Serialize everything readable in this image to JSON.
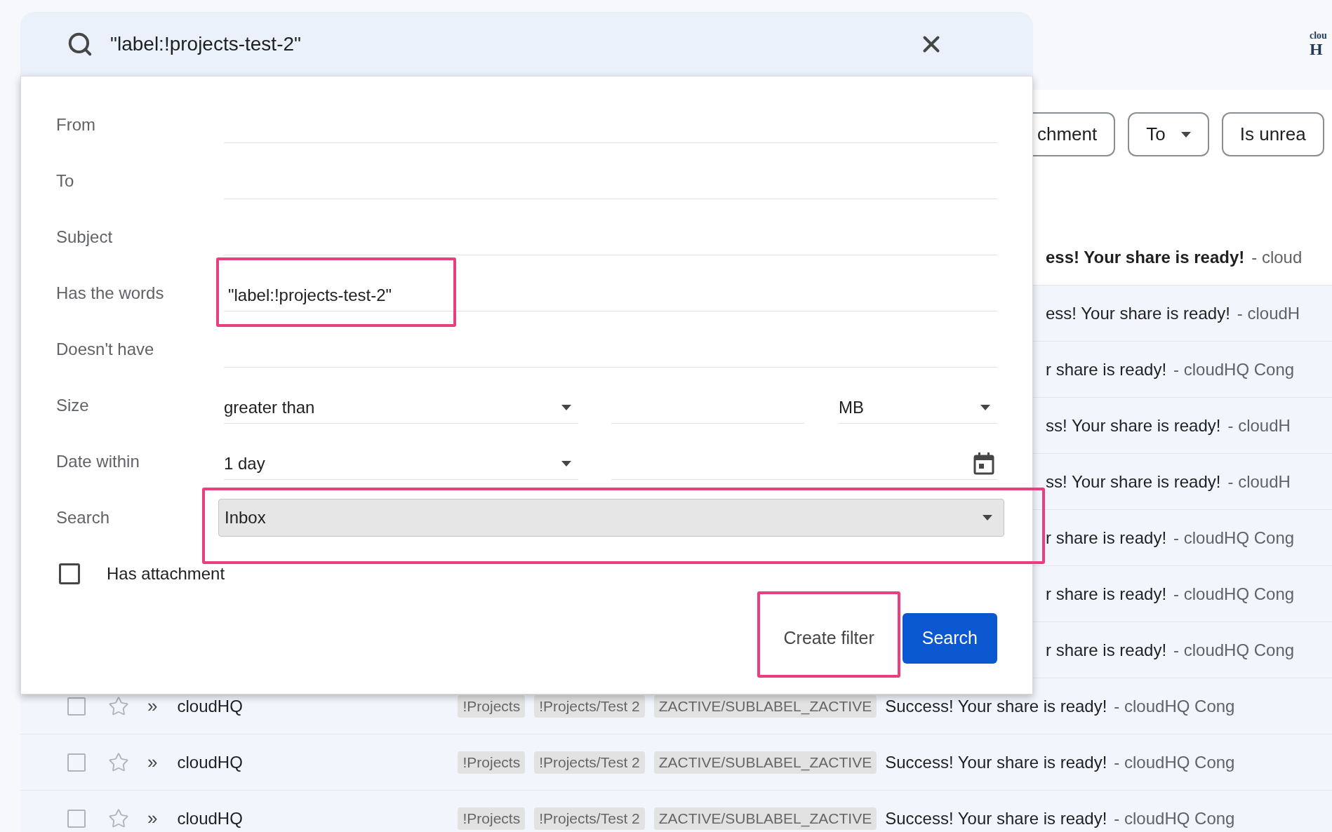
{
  "search_bar": {
    "query": "\"label:!projects-test-2\""
  },
  "logo": {
    "line_1": "clou",
    "line_2": "H"
  },
  "filter_chips": [
    {
      "label": "chment",
      "dropdown": false
    },
    {
      "label": "To",
      "dropdown": true
    },
    {
      "label": "Is unrea",
      "dropdown": false
    }
  ],
  "filter_dialog": {
    "fields": [
      {
        "kind": "text",
        "label": "From",
        "highlight": false
      },
      {
        "kind": "text",
        "label": "To",
        "highlight": false
      },
      {
        "kind": "text",
        "label": "Subject",
        "highlight": false
      },
      {
        "kind": "text",
        "label": "Has the words",
        "value": "\"label:!projects-test-2\"",
        "highlight": true
      },
      {
        "kind": "text",
        "label": "Doesn't have",
        "highlight": false
      },
      {
        "kind": "size",
        "label": "Size",
        "operator": "greater than",
        "unit": "MB",
        "highlight": false
      },
      {
        "kind": "date",
        "label": "Date within",
        "range": "1 day",
        "highlight": false
      },
      {
        "kind": "select",
        "label": "Search",
        "value": "Inbox",
        "highlight": true
      },
      {
        "kind": "checkbox",
        "label": "Has attachment",
        "checked": false,
        "highlight": false
      }
    ],
    "actions": [
      {
        "kind": "text",
        "label": "Create filter",
        "highlight": true
      },
      {
        "kind": "primary",
        "label": "Search",
        "highlight": false
      }
    ]
  },
  "email_rows": [
    {
      "kind": "partial",
      "unread": true,
      "subject": "ess! Your share is ready!",
      "snippet": "- cloud"
    },
    {
      "kind": "partial",
      "unread": false,
      "subject": "ess! Your share is ready!",
      "snippet": "- cloudH"
    },
    {
      "kind": "partial",
      "unread": false,
      "subject": "r share is ready!",
      "snippet": "- cloudHQ Cong"
    },
    {
      "kind": "partial",
      "unread": false,
      "subject": "ss! Your share is ready!",
      "snippet": "- cloudH"
    },
    {
      "kind": "partial",
      "unread": false,
      "subject": "ss! Your share is ready!",
      "snippet": "- cloudH"
    },
    {
      "kind": "partial",
      "unread": false,
      "subject": "r share is ready!",
      "snippet": "- cloudHQ Cong"
    },
    {
      "kind": "partial",
      "unread": false,
      "subject": "r share is ready!",
      "snippet": "- cloudHQ Cong"
    },
    {
      "kind": "partial",
      "unread": false,
      "subject": "r share is ready!",
      "snippet": "- cloudHQ Cong"
    },
    {
      "kind": "full",
      "unread": false,
      "checked": false,
      "starred": false,
      "marker": "»",
      "sender": "cloudHQ",
      "labels": [
        "!Projects",
        "!Projects/Test 2",
        "ZACTIVE/SUBLABEL_ZACTIVE"
      ],
      "subject": "Success! Your share is ready!",
      "snippet": "- cloudHQ Cong"
    },
    {
      "kind": "full",
      "unread": false,
      "checked": false,
      "starred": false,
      "marker": "»",
      "sender": "cloudHQ",
      "labels": [
        "!Projects",
        "!Projects/Test 2",
        "ZACTIVE/SUBLABEL_ZACTIVE"
      ],
      "subject": "Success! Your share is ready!",
      "snippet": "- cloudHQ Cong"
    },
    {
      "kind": "full",
      "unread": false,
      "checked": false,
      "starred": false,
      "marker": "»",
      "sender": "cloudHQ",
      "labels": [
        "!Projects",
        "!Projects/Test 2",
        "ZACTIVE/SUBLABEL_ZACTIVE"
      ],
      "subject": "Success! Your share is ready!",
      "snippet": "- cloudHQ Cong"
    }
  ]
}
